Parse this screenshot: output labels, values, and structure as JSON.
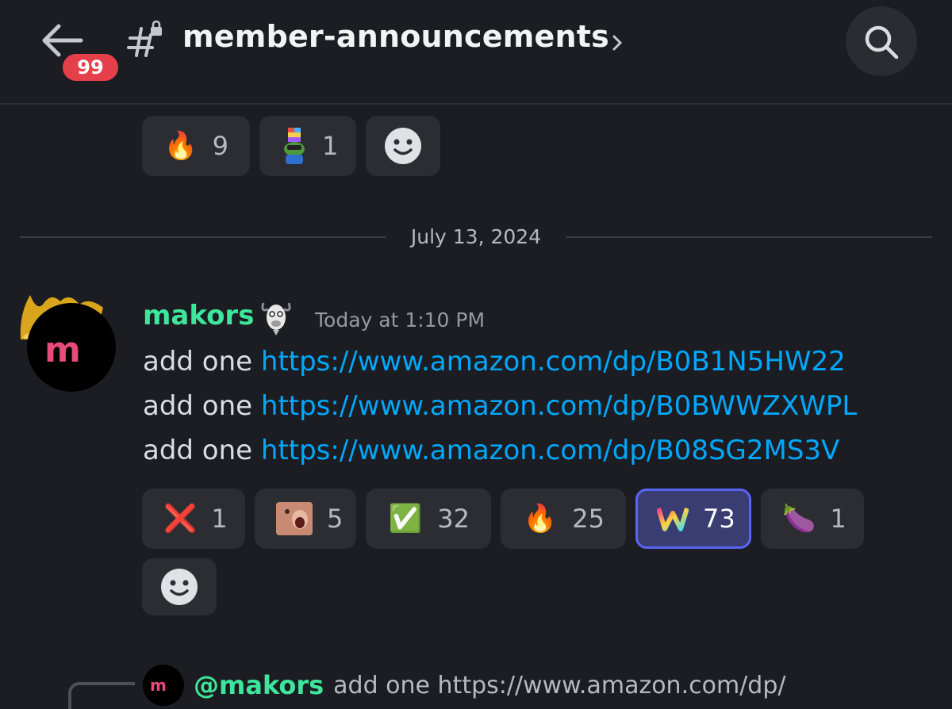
{
  "header": {
    "unread_count": "99",
    "channel_name": "member-announcements",
    "icons": {
      "back": "arrow-left-icon",
      "channel": "locked-hash-icon",
      "chevron": "chevron-right-icon",
      "search": "search-icon"
    }
  },
  "top_reactions": [
    {
      "emoji": "🔥",
      "count": "9",
      "name": "fire"
    },
    {
      "emoji": "",
      "count": "1",
      "name": "custom-pepe"
    }
  ],
  "date_divider": "July 13, 2024",
  "message": {
    "author": "makors",
    "timestamp": "Today at 1:10 PM",
    "lines": [
      {
        "prefix": "add one ",
        "link": "https://www.amazon.com/dp/B0B1N5HW22"
      },
      {
        "prefix": "add one ",
        "link": "https://www.amazon.com/dp/B0BWWZXWPL"
      },
      {
        "prefix": "add one ",
        "link": "https://www.amazon.com/dp/B08SG2MS3V"
      }
    ],
    "reactions": [
      {
        "emoji": "❌",
        "count": "1",
        "name": "cross-mark",
        "active": false
      },
      {
        "emoji": "",
        "count": "5",
        "name": "custom-face",
        "active": false
      },
      {
        "emoji": "✅",
        "count": "32",
        "name": "check-mark",
        "active": false
      },
      {
        "emoji": "🔥",
        "count": "25",
        "name": "fire",
        "active": false
      },
      {
        "emoji": "",
        "count": "73",
        "name": "custom-w",
        "active": true
      },
      {
        "emoji": "🍆",
        "count": "1",
        "name": "eggplant",
        "active": false
      }
    ]
  },
  "reply_preview": {
    "mention": "@makors",
    "text": "add one https://www.amazon.com/dp/"
  },
  "colors": {
    "background": "#1c1d22",
    "author": "#3ee69c",
    "link": "#00a8fc",
    "active_reaction": "#393d72",
    "badge": "#e5404a"
  }
}
